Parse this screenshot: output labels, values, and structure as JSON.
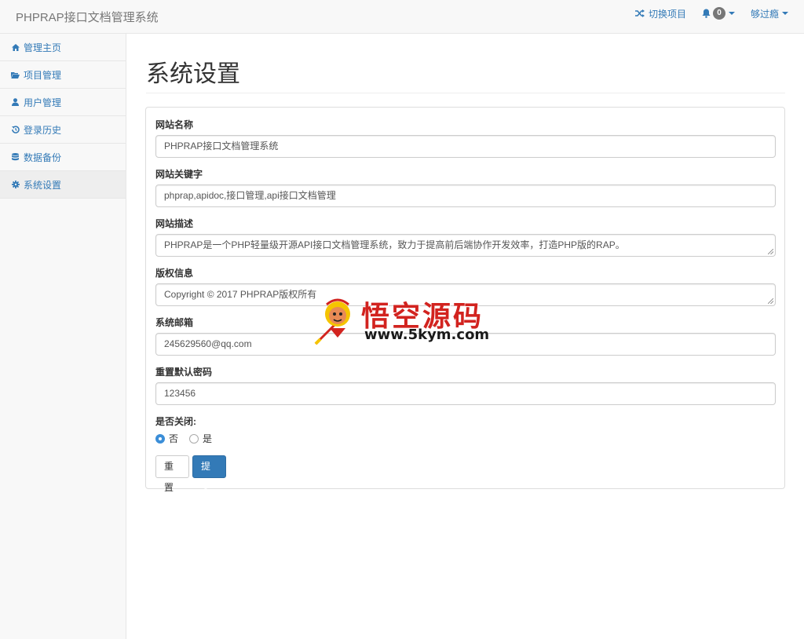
{
  "navbar": {
    "brand": "PHPRAP接口文档管理系统",
    "switch_project": "切换项目",
    "notification_count": "0",
    "user_name": "够过瘾"
  },
  "sidebar": {
    "items": [
      {
        "label": "管理主页",
        "icon": "home-icon"
      },
      {
        "label": "项目管理",
        "icon": "folder-open-icon"
      },
      {
        "label": "用户管理",
        "icon": "user-icon"
      },
      {
        "label": "登录历史",
        "icon": "history-icon"
      },
      {
        "label": "数据备份",
        "icon": "database-icon"
      },
      {
        "label": "系统设置",
        "icon": "gear-icon"
      }
    ],
    "active_index": 5
  },
  "page": {
    "title": "系统设置"
  },
  "form": {
    "site_name": {
      "label": "网站名称",
      "value": "PHPRAP接口文档管理系统"
    },
    "site_keywords": {
      "label": "网站关键字",
      "value": "phprap,apidoc,接口管理,api接口文档管理"
    },
    "site_description": {
      "label": "网站描述",
      "value": "PHPRAP是一个PHP轻量级开源API接口文档管理系统，致力于提高前后端协作开发效率，打造PHP版的RAP。"
    },
    "copyright": {
      "label": "版权信息",
      "value": "Copyright © 2017 PHPRAP版权所有"
    },
    "system_email": {
      "label": "系统邮箱",
      "value": "245629560@qq.com"
    },
    "default_password": {
      "label": "重置默认密码",
      "value": "123456"
    },
    "closed": {
      "label": "是否关闭:",
      "options": [
        "否",
        "是"
      ],
      "selected": "否"
    },
    "reset_label": "重置",
    "submit_label": "提交"
  },
  "watermark": {
    "text": "悟空源码",
    "url": "www.5kym.com"
  },
  "colors": {
    "link": "#337ab7",
    "primary": "#337ab7",
    "watermark_red": "#d2231f"
  }
}
